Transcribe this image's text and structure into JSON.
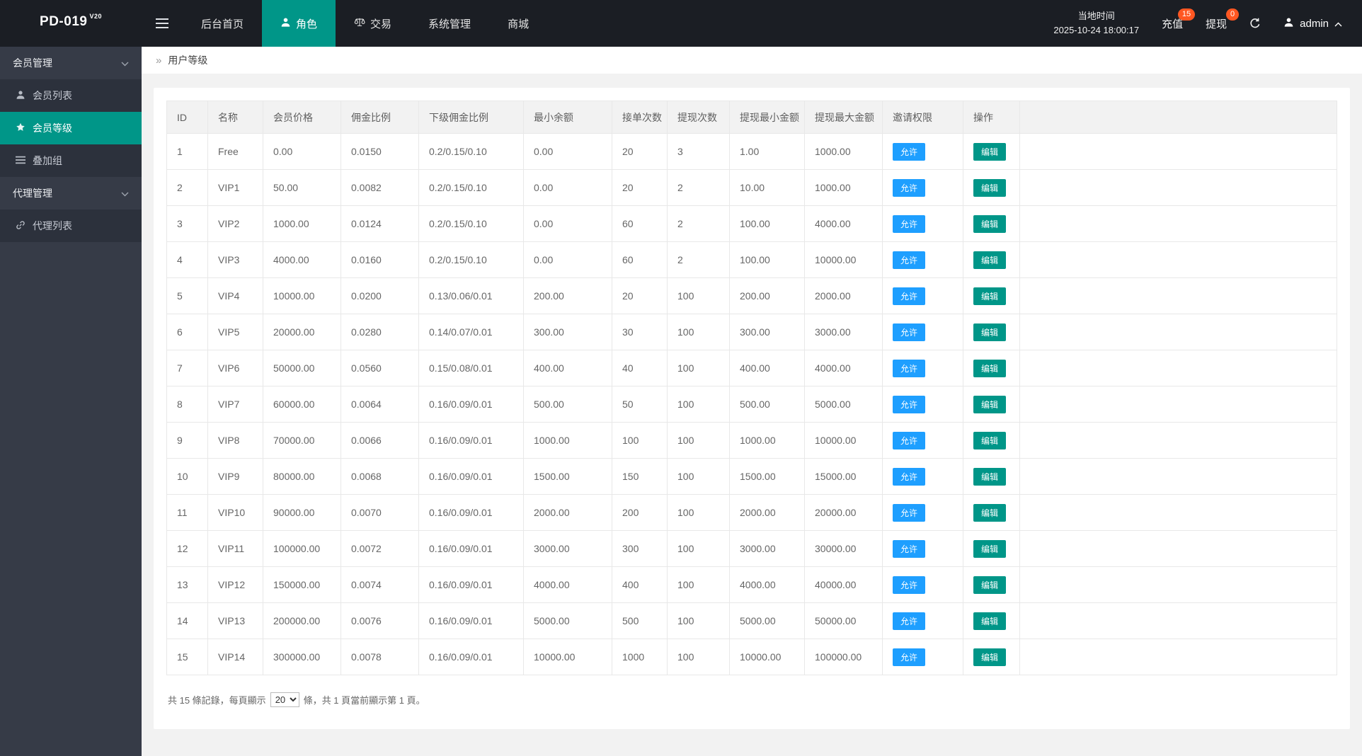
{
  "app": {
    "logo": "PD-019",
    "logo_sup": "V20"
  },
  "colors": {
    "primary": "#009688",
    "blue": "#1E9FFF",
    "badge": "#FF5722",
    "topbar": "#1b1e24",
    "sidebar": "#363b47"
  },
  "topnav": {
    "items": [
      {
        "label": "后台首页"
      },
      {
        "label": "角色",
        "active": true,
        "icon": "user-icon"
      },
      {
        "label": "交易",
        "icon": "scales-icon"
      },
      {
        "label": "系统管理"
      },
      {
        "label": "商城"
      }
    ],
    "time_label": "当地时间",
    "time_value": "2025-10-24 18:00:17",
    "recharge": {
      "label": "充值",
      "badge": "15"
    },
    "withdraw": {
      "label": "提现",
      "badge": "0"
    },
    "admin": "admin"
  },
  "sidebar": {
    "sections": [
      {
        "label": "会员管理",
        "items": [
          {
            "label": "会员列表",
            "icon": "user-icon"
          },
          {
            "label": "会员等级",
            "icon": "grade-icon",
            "active": true
          },
          {
            "label": "叠加组",
            "icon": "list-icon"
          }
        ]
      },
      {
        "label": "代理管理",
        "items": [
          {
            "label": "代理列表",
            "icon": "link-icon"
          }
        ]
      }
    ]
  },
  "breadcrumb": {
    "separator": "»",
    "label": "用户等级"
  },
  "table": {
    "headers": [
      "ID",
      "名称",
      "会员价格",
      "佣金比例",
      "下级佣金比例",
      "最小余额",
      "接单次数",
      "提现次数",
      "提现最小金额",
      "提现最大金额",
      "邀请权限",
      "操作"
    ],
    "allow_label": "允许",
    "edit_label": "编辑",
    "rows": [
      [
        "1",
        "Free",
        "0.00",
        "0.0150",
        "0.2/0.15/0.10",
        "0.00",
        "20",
        "3",
        "1.00",
        "1000.00"
      ],
      [
        "2",
        "VIP1",
        "50.00",
        "0.0082",
        "0.2/0.15/0.10",
        "0.00",
        "20",
        "2",
        "10.00",
        "1000.00"
      ],
      [
        "3",
        "VIP2",
        "1000.00",
        "0.0124",
        "0.2/0.15/0.10",
        "0.00",
        "60",
        "2",
        "100.00",
        "4000.00"
      ],
      [
        "4",
        "VIP3",
        "4000.00",
        "0.0160",
        "0.2/0.15/0.10",
        "0.00",
        "60",
        "2",
        "100.00",
        "10000.00"
      ],
      [
        "5",
        "VIP4",
        "10000.00",
        "0.0200",
        "0.13/0.06/0.01",
        "200.00",
        "20",
        "100",
        "200.00",
        "2000.00"
      ],
      [
        "6",
        "VIP5",
        "20000.00",
        "0.0280",
        "0.14/0.07/0.01",
        "300.00",
        "30",
        "100",
        "300.00",
        "3000.00"
      ],
      [
        "7",
        "VIP6",
        "50000.00",
        "0.0560",
        "0.15/0.08/0.01",
        "400.00",
        "40",
        "100",
        "400.00",
        "4000.00"
      ],
      [
        "8",
        "VIP7",
        "60000.00",
        "0.0064",
        "0.16/0.09/0.01",
        "500.00",
        "50",
        "100",
        "500.00",
        "5000.00"
      ],
      [
        "9",
        "VIP8",
        "70000.00",
        "0.0066",
        "0.16/0.09/0.01",
        "1000.00",
        "100",
        "100",
        "1000.00",
        "10000.00"
      ],
      [
        "10",
        "VIP9",
        "80000.00",
        "0.0068",
        "0.16/0.09/0.01",
        "1500.00",
        "150",
        "100",
        "1500.00",
        "15000.00"
      ],
      [
        "11",
        "VIP10",
        "90000.00",
        "0.0070",
        "0.16/0.09/0.01",
        "2000.00",
        "200",
        "100",
        "2000.00",
        "20000.00"
      ],
      [
        "12",
        "VIP11",
        "100000.00",
        "0.0072",
        "0.16/0.09/0.01",
        "3000.00",
        "300",
        "100",
        "3000.00",
        "30000.00"
      ],
      [
        "13",
        "VIP12",
        "150000.00",
        "0.0074",
        "0.16/0.09/0.01",
        "4000.00",
        "400",
        "100",
        "4000.00",
        "40000.00"
      ],
      [
        "14",
        "VIP13",
        "200000.00",
        "0.0076",
        "0.16/0.09/0.01",
        "5000.00",
        "500",
        "100",
        "5000.00",
        "50000.00"
      ],
      [
        "15",
        "VIP14",
        "300000.00",
        "0.0078",
        "0.16/0.09/0.01",
        "10000.00",
        "1000",
        "100",
        "10000.00",
        "100000.00"
      ]
    ]
  },
  "pagination": {
    "text_before": "共 15 條記錄，每頁顯示",
    "options": [
      "20"
    ],
    "selected": "20",
    "text_after": "條，共 1 頁當前顯示第 1 頁。"
  }
}
